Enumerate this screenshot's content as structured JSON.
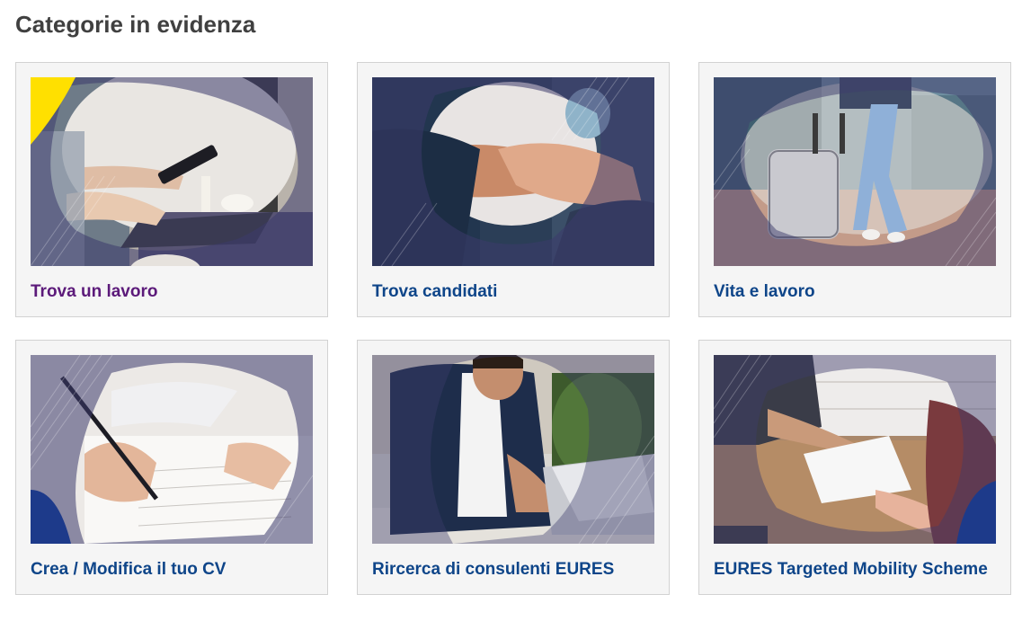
{
  "section": {
    "title": "Categorie in evidenza"
  },
  "colors": {
    "link": "#0e4589",
    "link_visited": "#5c1a7a",
    "overlay": "#3d3b6b",
    "accent_yellow": "#ffe000",
    "accent_blue": "#1d3a8a",
    "card_bg": "#f5f5f5",
    "card_border": "#d2d2d2"
  },
  "cards": [
    {
      "label": "Trova un lavoro",
      "image": "person-typing-laptop-holding-phone",
      "visited": true
    },
    {
      "label": "Trova candidati",
      "image": "business-handshake"
    },
    {
      "label": "Vita e lavoro",
      "image": "traveler-with-suitcase"
    },
    {
      "label": "Crea / Modifica il tuo CV",
      "image": "hand-writing-document"
    },
    {
      "label": "Rircerca di consulenti EURES",
      "image": "man-on-phone-with-laptop"
    },
    {
      "label": "EURES Targeted Mobility Scheme",
      "image": "handing-over-envelope"
    }
  ]
}
